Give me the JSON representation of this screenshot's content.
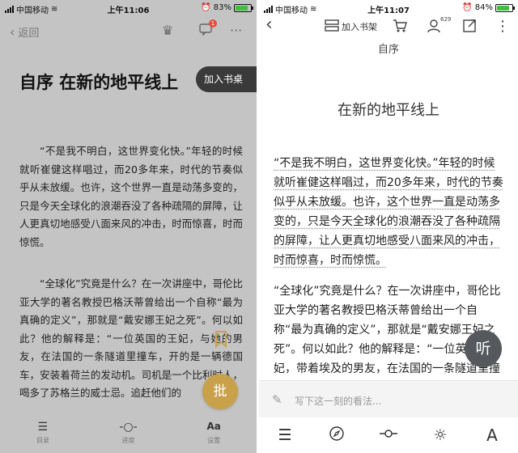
{
  "left": {
    "status": {
      "carrier": "中国移动",
      "time": "上午11:06",
      "battery": "83%",
      "battery_level": 0.83
    },
    "nav": {
      "back_label": "返回",
      "badge_count": "1"
    },
    "title": "自序 在新的地平线上",
    "add_shelf": "加入书桌",
    "paragraphs": [
      "“不是我不明白，这世界变化快。”年轻的时候就听崔健这样唱过，而20多年来，时代的节奏似乎从未放缓。也许，这个世界一直是动荡多变的，只是今天全球化的浪潮吞没了各种疏隔的屏障，让人更真切地感受八面来风的冲击，时而惊喜，时而惊慌。",
      "“全球化”究竟是什么？在一次讲座中，哥伦比亚大学的著名教授巴格沃蒂曾给出一个自称“最为真确的定义”，那就是“戴安娜王妃之死”。何以如此？他的解释是：“一位英国的王妃，与她的男友，在法国的一条隧道里撞车，开的是一辆德国车，安装着荷兰的发动机。司机是一个比利时人，喝多了苏格兰的威士忌。追赶他们的"
    ],
    "fab_label": "批",
    "bottom_bar": [
      {
        "glyph": "☰",
        "label": "目录"
      },
      {
        "glyph": "-○-",
        "label": "进度"
      },
      {
        "glyph": "Aa",
        "label": "设置"
      }
    ]
  },
  "right": {
    "status": {
      "carrier": "中国移动",
      "time": "上午11:07",
      "battery": "84%",
      "battery_level": 0.84
    },
    "nav": {
      "add_shelf_label": "加入书架",
      "user_count": "629"
    },
    "chapter": "自序",
    "title": "在新的地平线上",
    "paragraph1": "“不是我不明白，这世界变化快。”年轻的时候就听崔健这样唱过，而20多年来，时代的节奏似乎从未放缓。也许，这个世界一直是动荡多变的，只是今天全球化的浪潮吞没了各种疏隔的屏障，让人更真切地感受八面来风的冲击，时而惊喜，时而惊慌。",
    "paragraph2": "“全球化”究竟是什么？在一次讲座中，哥伦比亚大学的著名教授巴格沃蒂曾给出一个自称“最为真确的定义”，那就是“戴安娜王妃之死”。何以如此？他的解释是：“一位英国的王妃，带着埃及的男友，在法国的一条隧道里撞",
    "listen_label": "听",
    "comment_placeholder": "写下这一刻的看法...",
    "bottom_icons": [
      "list-icon",
      "compass-icon",
      "progress-icon",
      "brightness-icon",
      "font-icon"
    ]
  }
}
